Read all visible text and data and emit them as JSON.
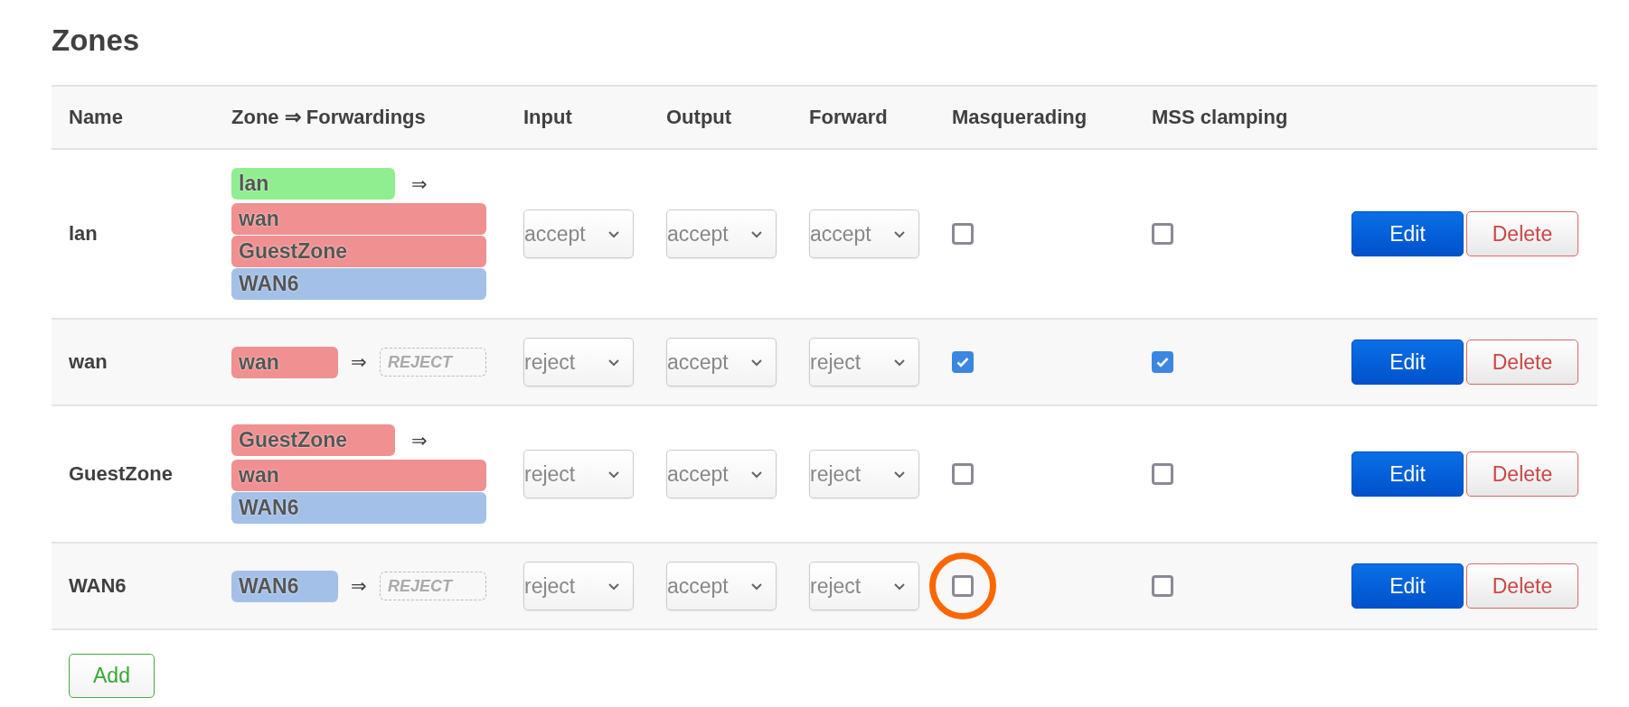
{
  "title": "Zones",
  "columns": [
    "Name",
    "Zone ⇒ Forwardings",
    "Input",
    "Output",
    "Forward",
    "Masquerading",
    "MSS clamping"
  ],
  "rows": [
    {
      "name": "lan",
      "zone": {
        "name": "lan",
        "color": "#90ee90"
      },
      "arrow": "⇒",
      "forwardings": [
        {
          "kind": "zone",
          "name": "wan",
          "color": "#f09090"
        },
        {
          "kind": "zone",
          "name": "GuestZone",
          "color": "#f09090"
        },
        {
          "kind": "zone",
          "name": "WAN6",
          "color": "#a3c1e8"
        }
      ],
      "input": "accept",
      "output": "accept",
      "forward": "accept",
      "masquerading": {
        "checked": false,
        "highlighted": false
      },
      "mss_clamping": {
        "checked": false
      },
      "edit": "Edit",
      "delete": "Delete"
    },
    {
      "name": "wan",
      "zone": {
        "name": "wan",
        "color": "#f09090"
      },
      "arrow": "⇒",
      "forwardings": [
        {
          "kind": "policy",
          "name": "REJECT"
        }
      ],
      "input": "reject",
      "output": "accept",
      "forward": "reject",
      "masquerading": {
        "checked": true,
        "highlighted": false
      },
      "mss_clamping": {
        "checked": true
      },
      "edit": "Edit",
      "delete": "Delete"
    },
    {
      "name": "GuestZone",
      "zone": {
        "name": "GuestZone",
        "color": "#f09090"
      },
      "arrow": "⇒",
      "forwardings": [
        {
          "kind": "zone",
          "name": "wan",
          "color": "#f09090"
        },
        {
          "kind": "zone",
          "name": "WAN6",
          "color": "#a3c1e8"
        }
      ],
      "input": "reject",
      "output": "accept",
      "forward": "reject",
      "masquerading": {
        "checked": false,
        "highlighted": false
      },
      "mss_clamping": {
        "checked": false
      },
      "edit": "Edit",
      "delete": "Delete"
    },
    {
      "name": "WAN6",
      "zone": {
        "name": "WAN6",
        "color": "#a3c1e8"
      },
      "arrow": "⇒",
      "forwardings": [
        {
          "kind": "policy",
          "name": "REJECT"
        }
      ],
      "input": "reject",
      "output": "accept",
      "forward": "reject",
      "masquerading": {
        "checked": false,
        "highlighted": true
      },
      "mss_clamping": {
        "checked": false
      },
      "edit": "Edit",
      "delete": "Delete"
    }
  ],
  "add_button": "Add"
}
